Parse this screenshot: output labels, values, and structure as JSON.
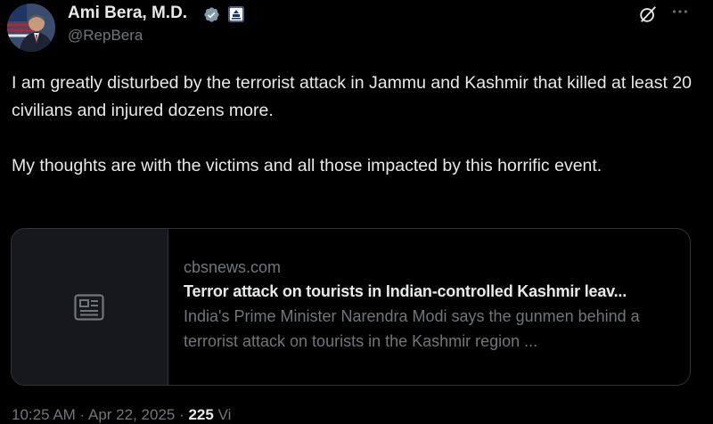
{
  "colors": {
    "background": "#000000",
    "text_primary": "#e7e9ea",
    "text_secondary": "#71767b",
    "verified_badge": "#829aab",
    "card_border": "#2f3336"
  },
  "author": {
    "name": "Ami Bera, M.D.",
    "handle": "@RepBera",
    "avatar_icon": "avatar-photo",
    "verified_icon": "verified-badge-icon",
    "affiliation_icon": "government-badge-icon"
  },
  "header_actions": {
    "grok_icon": "grok-icon",
    "more_icon": "more-icon"
  },
  "tweet": {
    "paragraph_1": "I am greatly disturbed by the terrorist attack in Jammu and Kashmir that killed at least 20 civilians and injured dozens more.",
    "paragraph_2": "My thoughts are with the victims and all those impacted by this horrific event."
  },
  "link_card": {
    "thumbnail_icon": "article-icon",
    "domain": "cbsnews.com",
    "title": "Terror attack on tourists in Indian-controlled Kashmir leav...",
    "description": "India's Prime Minister Narendra Modi says the gunmen behind a terrorist attack on tourists in the Kashmir region ..."
  },
  "meta": {
    "time": "10:25 AM",
    "separator": " · ",
    "date": "Apr 22, 2025",
    "separator_2": " · ",
    "views_count": "225",
    "views_label": " Vi"
  }
}
